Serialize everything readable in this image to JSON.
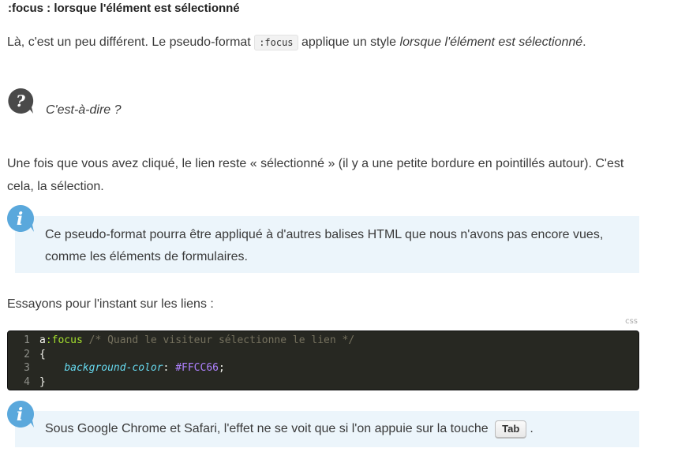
{
  "section_title": ":focus : lorsque l'élément est sélectionné",
  "para1": {
    "part1": "Là, c'est un peu différent. Le pseudo-format ",
    "code": ":focus",
    "part2": " applique un style ",
    "em": "lorsque l'élément est sélectionné",
    "part3": "."
  },
  "question": {
    "icon": "question-icon",
    "text": "C'est-à-dire ?"
  },
  "para2": "Une fois que vous avez cliqué, le lien reste « sélectionné » (il y a une petite bordure en pointillés autour). C'est cela, la sélection.",
  "info1": {
    "icon": "info-icon",
    "text": "Ce pseudo-format pourra être appliqué à d'autres balises HTML que nous n'avons pas encore vues, comme les éléments de formulaires."
  },
  "para3": "Essayons pour l'instant sur les liens :",
  "code": {
    "lang": "css",
    "lines": [
      {
        "n": "1",
        "selector": "a",
        "pseudo": ":focus",
        "comment": " /* Quand le visiteur sélectionne le lien */"
      },
      {
        "n": "2",
        "text": "{"
      },
      {
        "n": "3",
        "prop": "background-color",
        "punct": ": ",
        "value": "#FFCC66",
        "end": ";"
      },
      {
        "n": "4",
        "text": "}"
      }
    ]
  },
  "info2": {
    "icon": "info-icon",
    "text_before": "Sous Google Chrome et Safari, l'effet ne se voit que si l'on appuie sur la touche",
    "key": "Tab",
    "text_after": "."
  },
  "colors": {
    "info_bg": "#ecf5fb",
    "icon_blue": "#5aa8dc",
    "question_icon": "#4a4a4a",
    "code_bg": "#272822"
  }
}
